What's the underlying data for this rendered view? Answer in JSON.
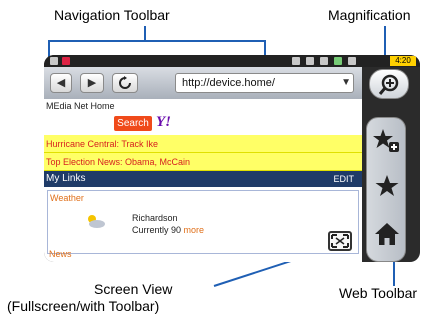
{
  "callouts": {
    "navigation_toolbar": "Navigation Toolbar",
    "magnification": "Magnification",
    "screen_view_line1": "Screen View",
    "screen_view_line2": "(Fullscreen/with Toolbar)",
    "web_toolbar": "Web Toolbar"
  },
  "status": {
    "clock": "4:20"
  },
  "browser": {
    "back_label": "◀",
    "forward_label": "▶",
    "url": "http://device.home/"
  },
  "page": {
    "header": "MEdia Net Home",
    "search_button": "Search",
    "search_logo": "Y!",
    "news1": "Hurricane Central: Track Ike",
    "news2": "Top Election News: Obama, McCain",
    "mylinks_label": "My Links",
    "edit_label": "EDIT",
    "weather_label": "Weather",
    "city": "Richardson",
    "temp": "Currently 90",
    "more": "more",
    "news_label": "News"
  },
  "colors": {
    "callout_line": "#1f5fb4",
    "news_bg": "#ffff66",
    "links_bar": "#1f3b68"
  },
  "icons": [
    "back-icon",
    "forward-icon",
    "refresh-icon",
    "dropdown-icon",
    "zoom-icon",
    "add-bookmark-icon",
    "star-icon",
    "home-icon",
    "fullscreen-icon",
    "weather-icon"
  ]
}
